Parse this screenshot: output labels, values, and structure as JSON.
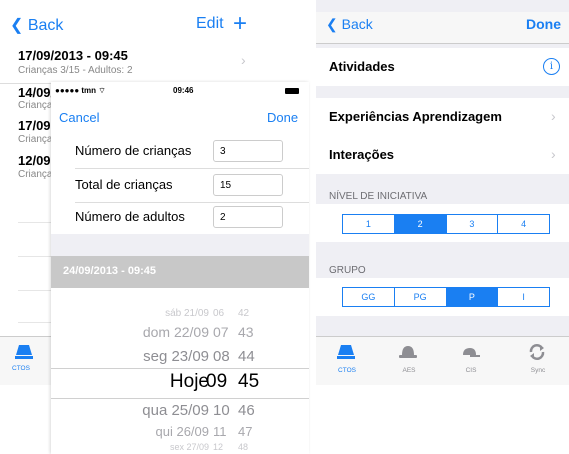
{
  "left": {
    "back_label": "Back",
    "edit_label": "Edit",
    "add_label": "+",
    "records": [
      {
        "datetime": "17/09/2013 - 09:45",
        "summary": "Crianças 3/15 - Adultos: 2"
      },
      {
        "datetime": "14/09/2013 - 09:45",
        "summary": "Crianças"
      },
      {
        "datetime": "17/09",
        "summary": "Crianças"
      },
      {
        "datetime": "12/09",
        "summary": "Crianças"
      }
    ],
    "tab_label": "CTOS"
  },
  "modal": {
    "status": {
      "carrier": "●●●●● tmn ⌔",
      "time": "09:46"
    },
    "cancel_label": "Cancel",
    "done_label": "Done",
    "fields": [
      {
        "label": "Número de crianças",
        "value": "3"
      },
      {
        "label": "Total de crianças",
        "value": "15"
      },
      {
        "label": "Número de adultos",
        "value": "2"
      }
    ],
    "selected_datetime": "24/09/2013 - 09:45",
    "picker": [
      {
        "date": "sáb 21/09",
        "hour": "06",
        "min": "42"
      },
      {
        "date": "dom 22/09",
        "hour": "07",
        "min": "43"
      },
      {
        "date": "seg 23/09",
        "hour": "08",
        "min": "44"
      },
      {
        "date": "Hoje",
        "hour": "09",
        "min": "45"
      },
      {
        "date": "qua 25/09",
        "hour": "10",
        "min": "46"
      },
      {
        "date": "qui 26/09",
        "hour": "11",
        "min": "47"
      },
      {
        "date": "sex 27/09",
        "hour": "12",
        "min": "48"
      }
    ]
  },
  "right": {
    "back_label": "Back",
    "done_label": "Done",
    "atividades_label": "Atividades",
    "info_label": "i",
    "experiencias_label": "Experiências Aprendizagem",
    "interacoes_label": "Interações",
    "nivel_header": "NÍVEL DE INICIATIVA",
    "nivel_options": [
      "1",
      "2",
      "3",
      "4"
    ],
    "nivel_selected": "2",
    "grupo_header": "GRUPO",
    "grupo_options": [
      "GG",
      "PG",
      "P",
      "I"
    ],
    "grupo_selected": "P",
    "tabs": [
      {
        "label": "CTOS",
        "icon": "ctos-icon"
      },
      {
        "label": "AES",
        "icon": "hat-icon"
      },
      {
        "label": "CIS",
        "icon": "cap-icon"
      },
      {
        "label": "Sync",
        "icon": "sync-icon"
      }
    ],
    "accent_color": "#1a7ff2"
  }
}
